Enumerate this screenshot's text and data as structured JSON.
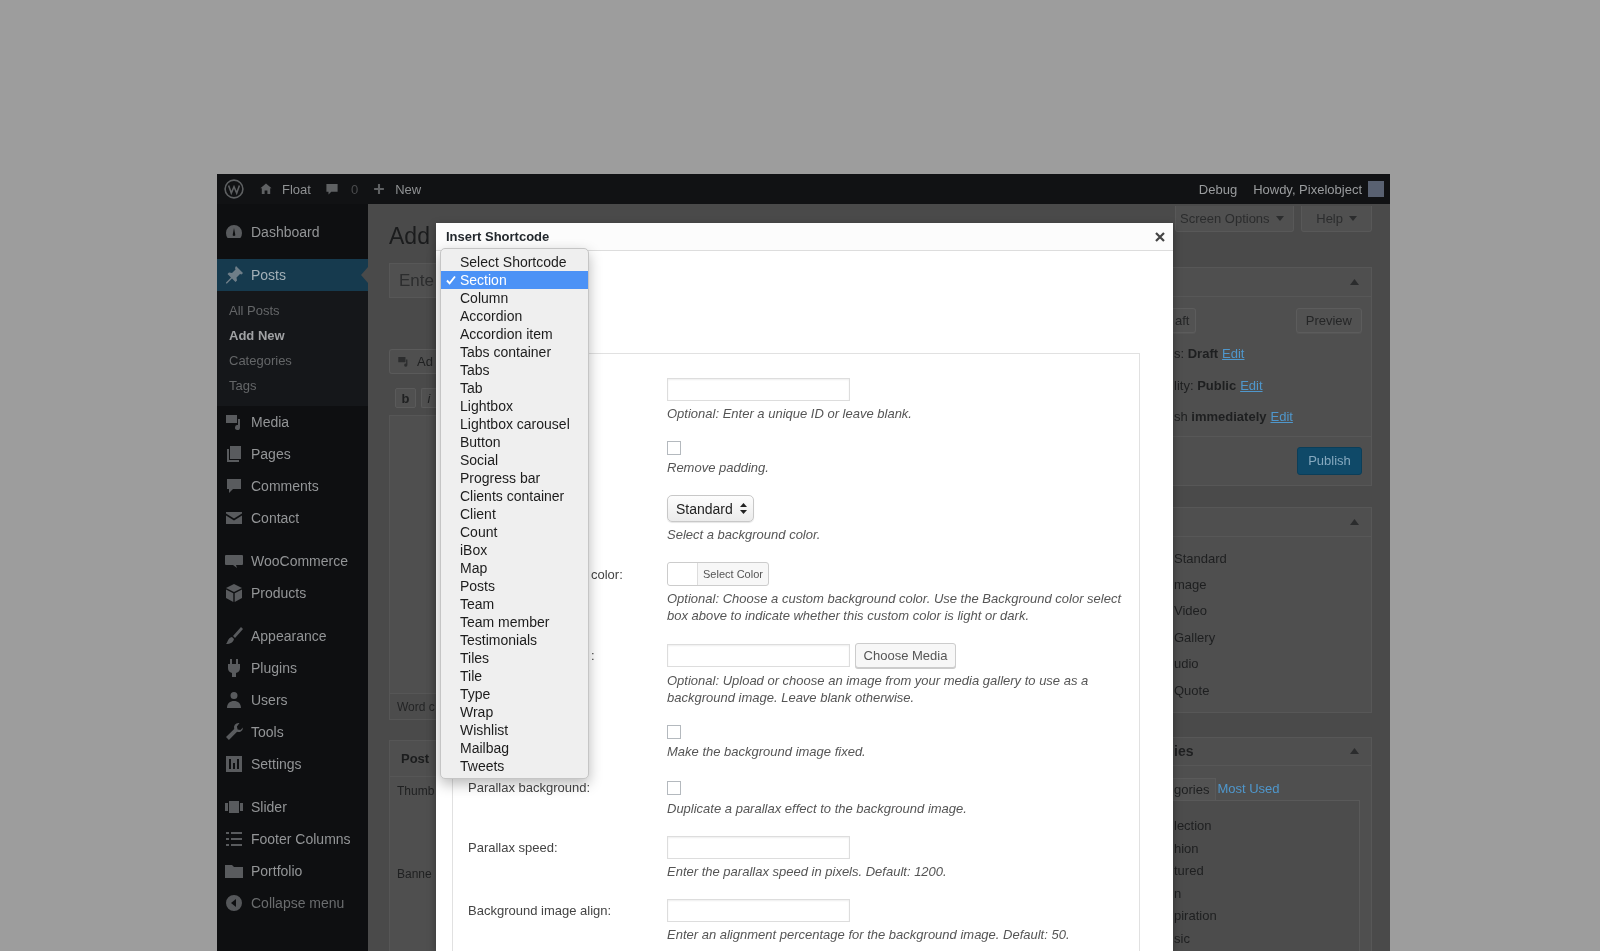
{
  "admin_bar": {
    "site": "Float",
    "comments": "0",
    "new": "New",
    "debug": "Debug",
    "greeting": "Howdy, Pixelobject"
  },
  "sidebar": {
    "groups": [
      {
        "items": [
          {
            "label": "Dashboard",
            "selected": false
          }
        ]
      },
      {
        "items": [
          {
            "label": "Posts",
            "selected": true,
            "children": [
              {
                "label": "All Posts",
                "selected": false
              },
              {
                "label": "Add New",
                "selected": true
              },
              {
                "label": "Categories",
                "selected": false
              },
              {
                "label": "Tags",
                "selected": false
              }
            ]
          },
          {
            "label": "Media",
            "selected": false
          },
          {
            "label": "Pages",
            "selected": false
          },
          {
            "label": "Comments",
            "selected": false
          },
          {
            "label": "Contact",
            "selected": false
          }
        ]
      },
      {
        "items": [
          {
            "label": "WooCommerce",
            "selected": false
          },
          {
            "label": "Products",
            "selected": false
          }
        ]
      },
      {
        "items": [
          {
            "label": "Appearance",
            "selected": false
          },
          {
            "label": "Plugins",
            "selected": false
          },
          {
            "label": "Users",
            "selected": false
          },
          {
            "label": "Tools",
            "selected": false
          },
          {
            "label": "Settings",
            "selected": false
          }
        ]
      },
      {
        "items": [
          {
            "label": "Slider",
            "selected": false
          },
          {
            "label": "Footer Columns",
            "selected": false
          },
          {
            "label": "Portfolio",
            "selected": false
          }
        ]
      }
    ],
    "collapse": "Collapse menu"
  },
  "editor": {
    "heading": "Add",
    "title_placeholder": "Ente",
    "add_media": "Ad",
    "format_buttons": [
      "b",
      "i"
    ],
    "word_count": "Word c",
    "post_box": {
      "title": "Post",
      "fields": [
        "Thumb",
        "Banne"
      ]
    }
  },
  "modal": {
    "title": "Insert Shortcode",
    "form": {
      "rows": [
        {
          "kind": "text",
          "description": "Optional: Enter a unique ID or leave blank."
        },
        {
          "kind": "checkbox",
          "checked": false,
          "description": "Remove padding."
        },
        {
          "kind": "select",
          "value": "Standard",
          "description": "Select a background color."
        },
        {
          "kind": "color",
          "label_tail": "color:",
          "button": "Select Color",
          "description": "Optional: Choose a custom background color. Use the Background color select box above to indicate whether this custom color is light or dark."
        },
        {
          "kind": "media",
          "label_tail": ":",
          "button": "Choose Media",
          "description": "Optional: Upload or choose an image from your media gallery to use as a background image. Leave blank otherwise."
        },
        {
          "kind": "checkbox",
          "checked": false,
          "description": "Make the background image fixed."
        },
        {
          "kind": "checkbox",
          "label": "Parallax background:",
          "checked": false,
          "description": "Duplicate a parallax effect to the background image."
        },
        {
          "kind": "text",
          "label": "Parallax speed:",
          "description": "Enter the parallax speed in pixels. Default: 1200."
        },
        {
          "kind": "text",
          "label": "Background image align:",
          "description": "Enter an alignment percentage for the background image. Default: 50."
        }
      ]
    }
  },
  "shortcode_menu": {
    "options": [
      {
        "label": "Select Shortcode",
        "selected": false
      },
      {
        "label": "Section",
        "selected": true
      },
      {
        "label": "Column",
        "selected": false
      },
      {
        "label": "Accordion",
        "selected": false
      },
      {
        "label": "Accordion item",
        "selected": false
      },
      {
        "label": "Tabs container",
        "selected": false
      },
      {
        "label": "Tabs",
        "selected": false
      },
      {
        "label": "Tab",
        "selected": false
      },
      {
        "label": "Lightbox",
        "selected": false
      },
      {
        "label": "Lightbox carousel",
        "selected": false
      },
      {
        "label": "Button",
        "selected": false
      },
      {
        "label": "Social",
        "selected": false
      },
      {
        "label": "Progress bar",
        "selected": false
      },
      {
        "label": "Clients container",
        "selected": false
      },
      {
        "label": "Client",
        "selected": false
      },
      {
        "label": "Count",
        "selected": false
      },
      {
        "label": "iBox",
        "selected": false
      },
      {
        "label": "Map",
        "selected": false
      },
      {
        "label": "Posts",
        "selected": false
      },
      {
        "label": "Team",
        "selected": false
      },
      {
        "label": "Team member",
        "selected": false
      },
      {
        "label": "Testimonials",
        "selected": false
      },
      {
        "label": "Tiles",
        "selected": false
      },
      {
        "label": "Tile",
        "selected": false
      },
      {
        "label": "Type",
        "selected": false
      },
      {
        "label": "Wrap",
        "selected": false
      },
      {
        "label": "Wishlist",
        "selected": false
      },
      {
        "label": "Mailbag",
        "selected": false
      },
      {
        "label": "Tweets",
        "selected": false
      }
    ]
  },
  "screen_meta": {
    "buttons": [
      "Screen Options",
      "Help"
    ]
  },
  "publish_box": {
    "buttons": [
      "aft",
      "Preview"
    ],
    "lines": [
      {
        "text": "s: **Draft**",
        "link": "Edit"
      },
      {
        "text": "lity: **Public**",
        "link": "Edit"
      },
      {
        "text": "sh **immediately**",
        "link": "Edit"
      }
    ],
    "publish": "Publish"
  },
  "format_box": {
    "options": [
      "Standard",
      "mage",
      "Video",
      "Gallery",
      "udio",
      "Quote"
    ]
  },
  "categories_box": {
    "title": "ies",
    "tabs": [
      {
        "label": "gories",
        "selected": true
      },
      {
        "label": "Most Used",
        "selected": false
      }
    ],
    "items": [
      "lection",
      "hion",
      "tured",
      "n",
      "piration",
      "sic"
    ]
  }
}
